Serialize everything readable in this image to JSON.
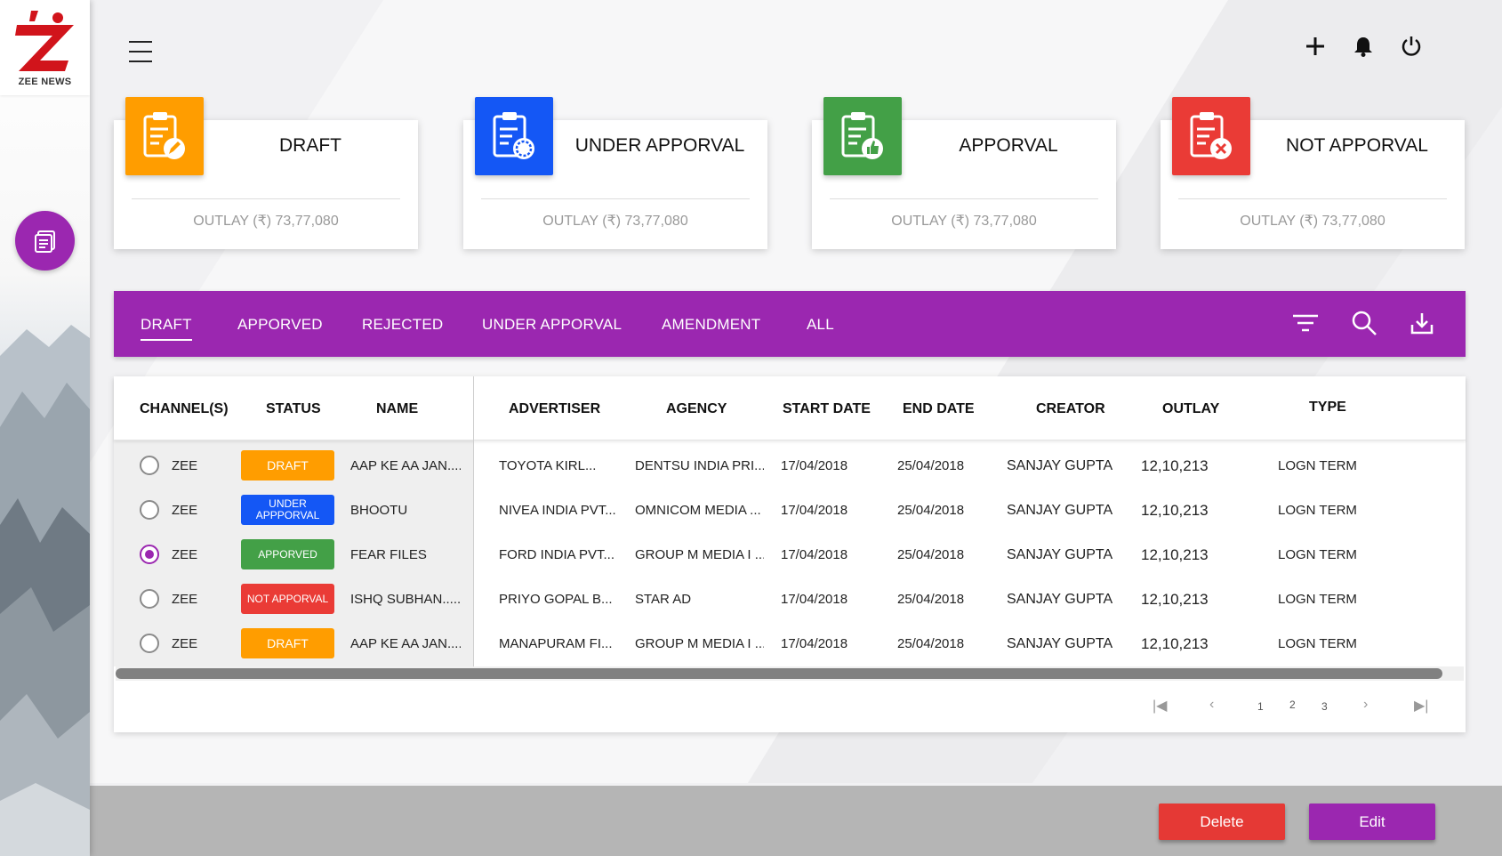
{
  "brand": {
    "name": "ZEE NEWS"
  },
  "cards": [
    {
      "title": "DRAFT",
      "outlay": "OUTLAY (₹) 73,77,080",
      "color": "#FF9D00"
    },
    {
      "title": "UNDER APPORVAL",
      "outlay": "OUTLAY (₹) 73,77,080",
      "color": "#1457F5"
    },
    {
      "title": "APPORVAL",
      "outlay": "OUTLAY (₹) 73,77,080",
      "color": "#43A047"
    },
    {
      "title": "NOT APPORVAL",
      "outlay": "OUTLAY (₹) 73,77,080",
      "color": "#EA3B36"
    }
  ],
  "tabs": [
    "DRAFT",
    "APPORVED",
    "REJECTED",
    "UNDER APPORVAL",
    "AMENDMENT",
    "ALL"
  ],
  "active_tab": "DRAFT",
  "tab_icons": [
    "filter-icon",
    "search-icon",
    "download-icon"
  ],
  "top_icons": [
    "plus-icon",
    "bell-icon",
    "power-icon"
  ],
  "table": {
    "headers": [
      "CHANNEL(S)",
      "STATUS",
      "NAME",
      "ADVERTISER",
      "AGENCY",
      "START DATE",
      "END DATE",
      "CREATOR",
      "OUTLAY",
      "TYPE"
    ],
    "rows": [
      {
        "selected": false,
        "channel": "ZEE",
        "status": "DRAFT",
        "status_color": "#FF9D00",
        "name": "AAP KE AA JAN....",
        "advertiser": "TOYOTA KIRL...",
        "agency": "DENTSU INDIA PRI...",
        "start": "17/04/2018",
        "end": "25/04/2018",
        "creator": "SANJAY GUPTA",
        "outlay": "12,10,213",
        "type": "LOGN TERM"
      },
      {
        "selected": false,
        "channel": "ZEE",
        "status": "UNDER APPPORVAL",
        "status_color": "#1457F5",
        "name": "BHOOTU",
        "advertiser": "NIVEA INDIA PVT...",
        "agency": "OMNICOM MEDIA ...",
        "start": "17/04/2018",
        "end": "25/04/2018",
        "creator": "SANJAY GUPTA",
        "outlay": "12,10,213",
        "type": "LOGN TERM"
      },
      {
        "selected": true,
        "channel": "ZEE",
        "status": "APPORVED",
        "status_color": "#43A047",
        "name": "FEAR FILES",
        "advertiser": "FORD INDIA PVT...",
        "agency": "GROUP M MEDIA I ...",
        "start": "17/04/2018",
        "end": "25/04/2018",
        "creator": "SANJAY GUPTA",
        "outlay": "12,10,213",
        "type": "LOGN TERM"
      },
      {
        "selected": false,
        "channel": "ZEE",
        "status": "NOT APPORVAL",
        "status_color": "#EA3B36",
        "name": "ISHQ SUBHAN.....",
        "advertiser": "PRIYO GOPAL B...",
        "agency": "STAR AD",
        "start": "17/04/2018",
        "end": "25/04/2018",
        "creator": "SANJAY GUPTA",
        "outlay": "12,10,213",
        "type": "LOGN TERM"
      },
      {
        "selected": false,
        "channel": "ZEE",
        "status": "DRAFT",
        "status_color": "#FF9D00",
        "name": "AAP KE AA JAN....",
        "advertiser": "MANAPURAM FI...",
        "agency": "GROUP M MEDIA I ...",
        "start": "17/04/2018",
        "end": "25/04/2018",
        "creator": "SANJAY GUPTA",
        "outlay": "12,10,213",
        "type": "LOGN TERM"
      }
    ]
  },
  "pagination": {
    "pages": [
      "1",
      "2",
      "3"
    ]
  },
  "actions": {
    "delete": "Delete",
    "edit": "Edit",
    "delete_color": "#E53935",
    "edit_color": "#9B27B0"
  },
  "accent": "#9B27B0"
}
